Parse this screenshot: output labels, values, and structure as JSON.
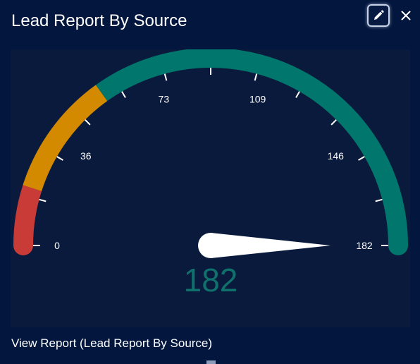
{
  "widget": {
    "title": "Lead Report By Source",
    "edit_icon": "pencil-icon",
    "close_icon": "close-icon",
    "view_report_label": "View Report (Lead Report By Source)"
  },
  "colors": {
    "background": "#03163d",
    "panel": "#0a1a3d",
    "band_low": "#c83b36",
    "band_mid": "#d38a00",
    "band_high": "#00766c",
    "value_text": "#10706b",
    "tick": "#ffffff"
  },
  "chart_data": {
    "type": "gauge",
    "min": 0,
    "max": 182,
    "value": 182,
    "value_label": "182",
    "tick_labels": [
      "0",
      "36",
      "73",
      "109",
      "146",
      "182"
    ],
    "tick_values": [
      0,
      36,
      73,
      109,
      146,
      182
    ],
    "bands": [
      {
        "from": 0,
        "to": 18,
        "color": "#c83b36"
      },
      {
        "from": 18,
        "to": 55,
        "color": "#d38a00"
      },
      {
        "from": 55,
        "to": 182,
        "color": "#00766c"
      }
    ]
  }
}
